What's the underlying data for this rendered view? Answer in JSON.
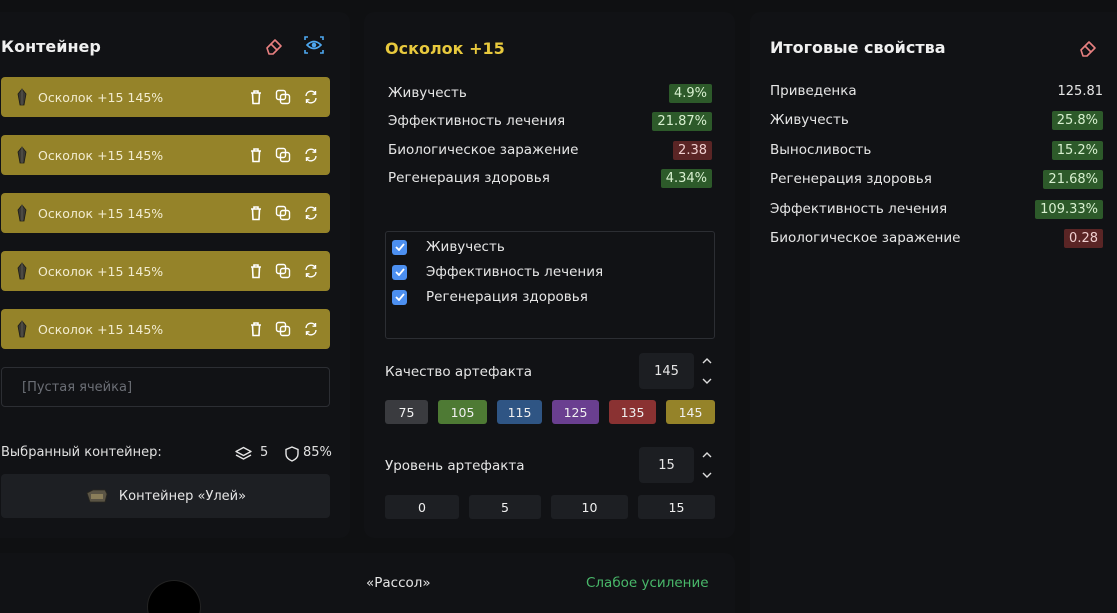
{
  "container": {
    "title": "Контейнер",
    "slots": [
      {
        "label": "Осколок +15 145%"
      },
      {
        "label": "Осколок +15 145%"
      },
      {
        "label": "Осколок +15 145%"
      },
      {
        "label": "Осколок +15 145%"
      },
      {
        "label": "Осколок +15 145%"
      }
    ],
    "empty_slot": "[Пустая ячейка]",
    "selected_label": "Выбранный контейнер:",
    "layers_count": "5",
    "protection": "85%",
    "container_name": "Контейнер «Улей»"
  },
  "artifact": {
    "title": "Осколок +15",
    "properties": [
      {
        "name": "Живучесть",
        "value": "4.9%",
        "tone": "green"
      },
      {
        "name": "Эффективность лечения",
        "value": "21.87%",
        "tone": "green"
      },
      {
        "name": "Биологическое заражение",
        "value": "2.38",
        "tone": "red"
      },
      {
        "name": "Регенерация здоровья",
        "value": "4.34%",
        "tone": "green"
      }
    ],
    "checked": [
      "Живучесть",
      "Эффективность лечения",
      "Регенерация здоровья"
    ],
    "quality_label": "Качество артефакта",
    "quality_value": "145",
    "quality_options": [
      "75",
      "105",
      "115",
      "125",
      "135",
      "145"
    ],
    "level_label": "Уровень артефакта",
    "level_value": "15",
    "level_options": [
      "0",
      "5",
      "10",
      "15"
    ]
  },
  "final": {
    "title": "Итоговые свойства",
    "rows": [
      {
        "name": "Приведенка",
        "value": "125.81",
        "tone": "plain"
      },
      {
        "name": "Живучесть",
        "value": "25.8%",
        "tone": "green"
      },
      {
        "name": "Выносливость",
        "value": "15.2%",
        "tone": "green"
      },
      {
        "name": "Регенерация здоровья",
        "value": "21.68%",
        "tone": "green"
      },
      {
        "name": "Эффективность лечения",
        "value": "109.33%",
        "tone": "green"
      },
      {
        "name": "Биологическое заражение",
        "value": "0.28",
        "tone": "red"
      }
    ]
  },
  "bottom": {
    "name": "«Рассол»",
    "status": "Слабое усиление"
  },
  "colors": {
    "accent_gold": "#958329",
    "title_gold": "#e8c93d",
    "positive": "#2d5a2a",
    "negative": "#5a2525",
    "check_blue": "#4c8ff0",
    "q75": "#3a3b3f",
    "q105": "#4e7a34",
    "q115": "#2f5584",
    "q125": "#6a3f90",
    "q135": "#8a3232",
    "q145": "#958329"
  }
}
